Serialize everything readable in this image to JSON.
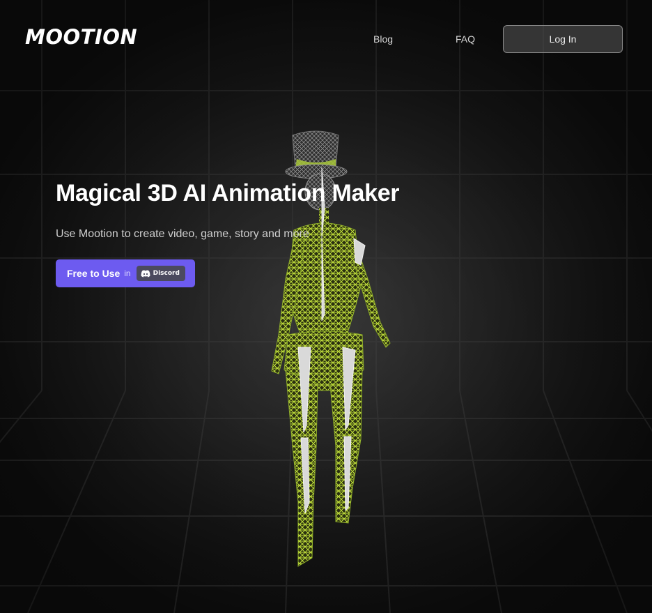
{
  "brand": {
    "logo_text": "MOOTION"
  },
  "nav": {
    "blog_label": "Blog",
    "faq_label": "FAQ",
    "login_label": "Log In"
  },
  "hero": {
    "title": "Magical 3D AI Animation Maker",
    "subtitle": "Use Mootion to create video, game, story and more",
    "cta_label": "Free to Use",
    "cta_in": "in",
    "cta_platform": "Discord"
  },
  "colors": {
    "accent": "#6d5bf0",
    "wireframe": "#b8d63a",
    "background": "#1a1a1a"
  },
  "icons": {
    "discord": "discord-icon",
    "figure": "wireframe-character"
  }
}
